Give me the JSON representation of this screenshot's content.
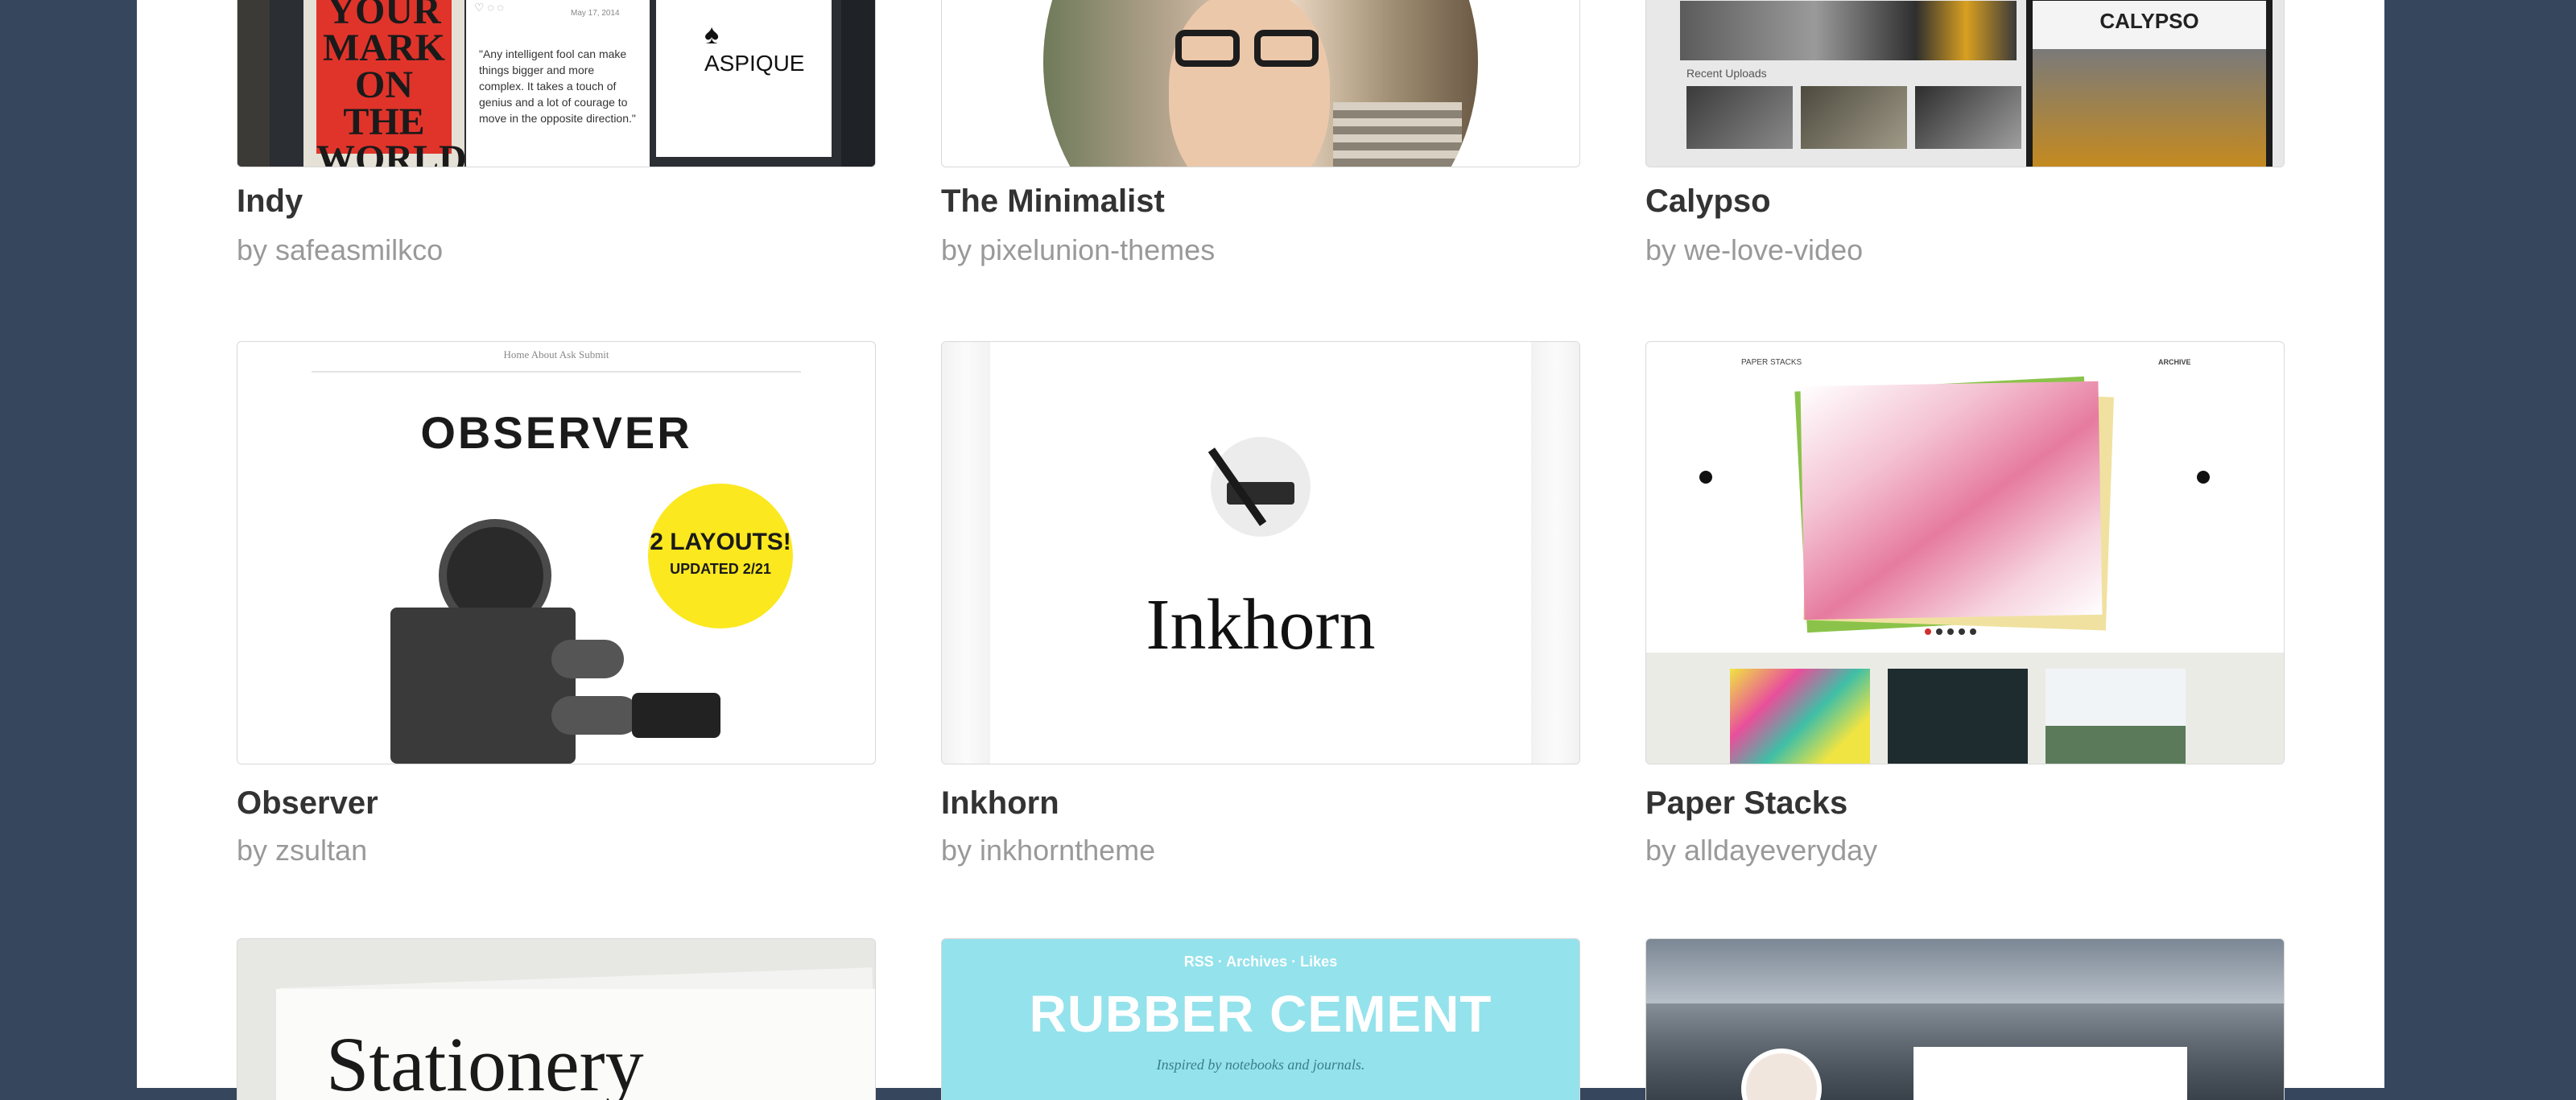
{
  "themes": [
    {
      "title": "Indy",
      "author": "by safeasmilkco"
    },
    {
      "title": "The Minimalist",
      "author": "by pixelunion-themes"
    },
    {
      "title": "Calypso",
      "author": "by we-love-video"
    },
    {
      "title": "Observer",
      "author": "by zsultan"
    },
    {
      "title": "Inkhorn",
      "author": "by inkhorntheme"
    },
    {
      "title": "Paper Stacks",
      "author": "by alldayeveryday"
    }
  ],
  "previews": {
    "indy": {
      "poster": [
        "YOUR",
        "MARK",
        "ON THE",
        "WORLD"
      ],
      "quote": "\"Any intelligent fool can make things bigger and more complex. It takes a touch of genius and a lot of courage to move in the opposite direction.\"",
      "date": "May 17, 2014",
      "card": "ASPIQUE"
    },
    "calypso": {
      "brand": "CALYPSO",
      "uploads": "Recent Uploads"
    },
    "observer": {
      "nav": "Home   About   Ask   Submit",
      "heading": "OBSERVER",
      "badge_1": "2 LAYOUTS!",
      "badge_2": "UPDATED 2/21"
    },
    "inkhorn": {
      "wordmark": "Inkhorn"
    },
    "paper_stacks": {
      "label": "PAPER STACKS",
      "archive": "ARCHIVE"
    },
    "stationery": {
      "wordmark": "Stationery"
    },
    "rubber_cement": {
      "nav": "RSS  ·  Archives  ·  Likes",
      "heading": "RUBBER CEMENT",
      "tagline": "Inspired by notebooks and journals."
    }
  }
}
